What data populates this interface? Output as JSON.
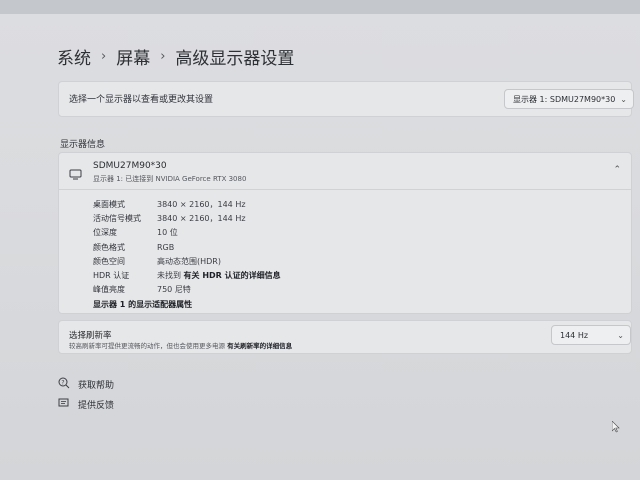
{
  "breadcrumb": {
    "items": [
      "系统",
      "屏幕",
      "高级显示器设置"
    ],
    "separator": "›"
  },
  "select_display": {
    "label": "选择一个显示器以查看或更改其设置",
    "dropdown_value": "显示器 1: SDMU27M90*30"
  },
  "section": {
    "title": "显示器信息"
  },
  "display_info": {
    "name": "SDMU27M90*30",
    "subtitle": "显示器 1: 已连接到 NVIDIA GeForce RTX 3080",
    "rows": [
      {
        "key": "桌面模式",
        "value": "3840 × 2160，144 Hz"
      },
      {
        "key": "活动信号模式",
        "value": "3840 × 2160，144 Hz"
      },
      {
        "key": "位深度",
        "value": "10 位"
      },
      {
        "key": "颜色格式",
        "value": "RGB"
      },
      {
        "key": "颜色空间",
        "value": "高动态范围(HDR)"
      },
      {
        "key": "HDR 认证",
        "value": "未找到",
        "link": "有关 HDR 认证的详细信息"
      },
      {
        "key": "峰值亮度",
        "value": "750 尼特"
      }
    ],
    "adapter_link": "显示器 1 的显示适配器属性"
  },
  "refresh": {
    "title": "选择刷新率",
    "desc": "较高刷新率可提供更流畅的动作，但也会使用更多电源",
    "desc_link": "有关刷新率的详细信息",
    "dropdown_value": "144 Hz"
  },
  "help": {
    "get_help": "获取帮助",
    "feedback": "提供反馈"
  },
  "icons": {
    "monitor": "monitor-icon",
    "chevron_down": "chevron-down-icon",
    "chevron_up": "chevron-up-icon",
    "help": "help-icon",
    "feedback": "feedback-icon"
  }
}
